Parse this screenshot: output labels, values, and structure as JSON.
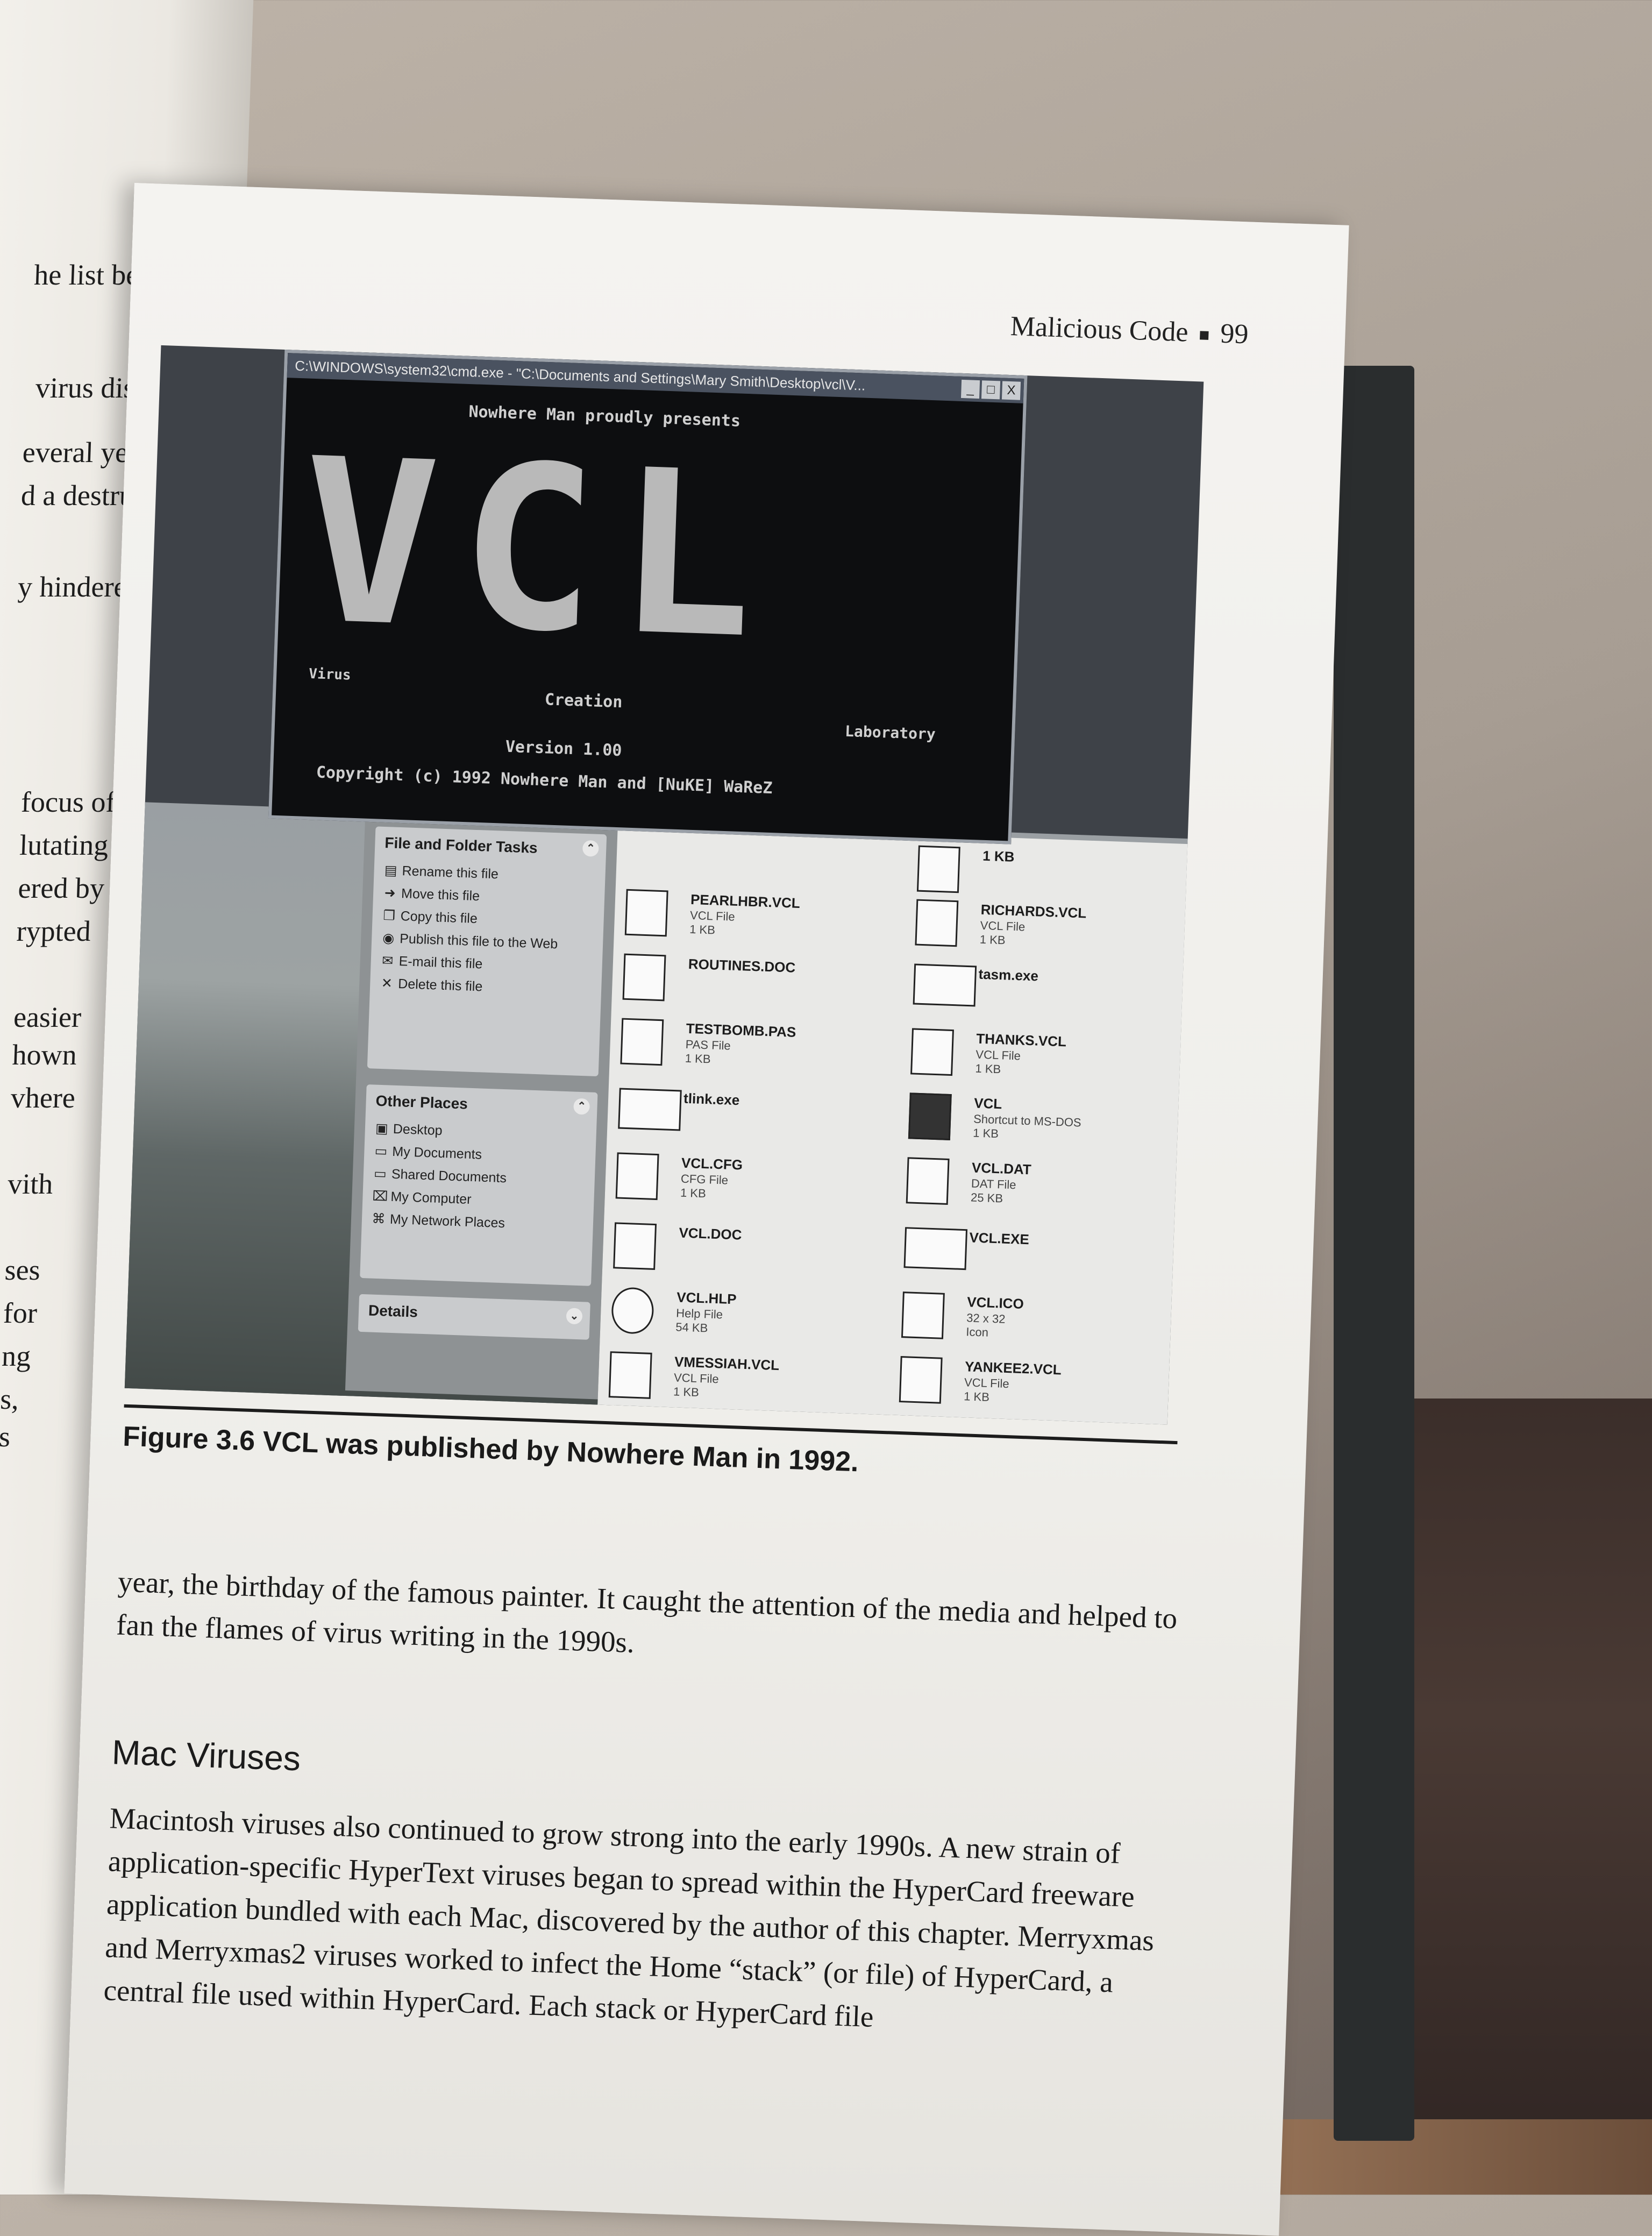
{
  "left_page": {
    "lines": [
      "he list below.",
      "virus discov",
      "everal years",
      "d a destruc",
      "y hindered",
      "focus of",
      "lutating",
      "ered by",
      "rypted",
      "easier",
      "hown",
      "vhere",
      "vith",
      "ses",
      "for",
      "ng",
      "s,",
      "s"
    ]
  },
  "header": {
    "title": "Malicious Code",
    "page_number": "99"
  },
  "figure": {
    "cmd": {
      "title": "C:\\WINDOWS\\system32\\cmd.exe - \"C:\\Documents and Settings\\Mary Smith\\Desktop\\vcl\\V...",
      "buttons": [
        "_",
        "□",
        "X"
      ],
      "presents": "Nowhere Man proudly presents",
      "big_letters": "VCL",
      "word_virus": "Virus",
      "word_creation": "Creation",
      "word_laboratory": "Laboratory",
      "version": "Version 1.00",
      "copyright": "Copyright (c) 1992 Nowhere Man and [NuKE] WaReZ"
    },
    "file_tasks": {
      "title": "File and Folder Tasks",
      "items": [
        {
          "icon": "rename-icon",
          "glyph": "▤",
          "label": "Rename this file"
        },
        {
          "icon": "move-icon",
          "glyph": "➜",
          "label": "Move this file"
        },
        {
          "icon": "copy-icon",
          "glyph": "❐",
          "label": "Copy this file"
        },
        {
          "icon": "publish-icon",
          "glyph": "◉",
          "label": "Publish this file to the Web"
        },
        {
          "icon": "email-icon",
          "glyph": "✉",
          "label": "E-mail this file"
        },
        {
          "icon": "delete-icon",
          "glyph": "✕",
          "label": "Delete this file"
        }
      ]
    },
    "other_places": {
      "title": "Other Places",
      "items": [
        {
          "icon": "desktop-icon",
          "glyph": "▣",
          "label": "Desktop"
        },
        {
          "icon": "documents-icon",
          "glyph": "▭",
          "label": "My Documents"
        },
        {
          "icon": "shared-icon",
          "glyph": "▭",
          "label": "Shared Documents"
        },
        {
          "icon": "computer-icon",
          "glyph": "⌧",
          "label": "My Computer"
        },
        {
          "icon": "network-icon",
          "glyph": "⌘",
          "label": "My Network Places"
        }
      ]
    },
    "details": {
      "title": "Details"
    },
    "files_left": [
      {
        "name": "PEARLHBR.VCL",
        "type": "VCL File",
        "size": "1 KB"
      },
      {
        "name": "ROUTINES.DOC",
        "type": "",
        "size": ""
      },
      {
        "name": "TESTBOMB.PAS",
        "type": "PAS File",
        "size": "1 KB"
      },
      {
        "name": "tlink.exe",
        "type": "",
        "size": ""
      },
      {
        "name": "VCL.CFG",
        "type": "CFG File",
        "size": "1 KB"
      },
      {
        "name": "VCL.DOC",
        "type": "",
        "size": ""
      },
      {
        "name": "VCL.HLP",
        "type": "Help File",
        "size": "54 KB"
      },
      {
        "name": "VMESSIAH.VCL",
        "type": "VCL File",
        "size": "1 KB"
      }
    ],
    "files_right": [
      {
        "name": "1 KB",
        "type": "",
        "size": ""
      },
      {
        "name": "RICHARDS.VCL",
        "type": "VCL File",
        "size": "1 KB"
      },
      {
        "name": "tasm.exe",
        "type": "",
        "size": ""
      },
      {
        "name": "THANKS.VCL",
        "type": "VCL File",
        "size": "1 KB"
      },
      {
        "name": "VCL",
        "type": "Shortcut to MS-DOS",
        "size": "1 KB"
      },
      {
        "name": "VCL.DAT",
        "type": "DAT File",
        "size": "25 KB"
      },
      {
        "name": "VCL.EXE",
        "type": "",
        "size": ""
      },
      {
        "name": "VCL.ICO",
        "type": "32 x 32",
        "size": "Icon"
      },
      {
        "name": "YANKEE2.VCL",
        "type": "VCL File",
        "size": "1 KB"
      }
    ]
  },
  "caption": "Figure 3.6   VCL was published by Nowhere Man in 1992.",
  "paragraph1": "year, the birthday of the famous painter. It caught the attention of the media and helped to fan the flames of virus writing in the 1990s.",
  "section_title": "Mac Viruses",
  "paragraph2": "Macintosh viruses also continued to grow strong into the early 1990s. A new strain of application-specific HyperText viruses began to spread within the HyperCard freeware application bundled with each Mac, discovered by the author of this chapter. Merryxmas and Merryxmas2 viruses worked to infect the Home “stack” (or file) of HyperCard, a central file used within HyperCard. Each stack or HyperCard file"
}
